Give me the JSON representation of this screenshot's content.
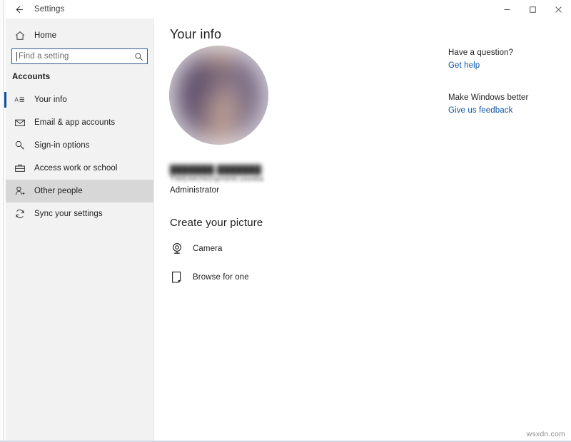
{
  "window": {
    "title": "Settings",
    "back_icon": "back-arrow-icon",
    "minimize_icon": "minimize-icon",
    "maximize_icon": "maximize-icon",
    "close_icon": "close-icon"
  },
  "sidebar": {
    "home": {
      "label": "Home",
      "icon": "home-icon"
    },
    "search": {
      "placeholder": "Find a setting",
      "value": "",
      "icon": "search-icon"
    },
    "section_title": "Accounts",
    "items": [
      {
        "label": "Your info",
        "icon": "contact-card-icon",
        "state": "selected"
      },
      {
        "label": "Email & app accounts",
        "icon": "envelope-icon",
        "state": "normal"
      },
      {
        "label": "Sign-in options",
        "icon": "key-icon",
        "state": "normal"
      },
      {
        "label": "Access work or school",
        "icon": "briefcase-icon",
        "state": "normal"
      },
      {
        "label": "Other people",
        "icon": "person-add-icon",
        "state": "hovered"
      },
      {
        "label": "Sync your settings",
        "icon": "sync-icon",
        "state": "normal"
      }
    ]
  },
  "main": {
    "page_title": "Your info",
    "account": {
      "avatar": "user-avatar-image",
      "name": "███████ ███████",
      "path": "TWEAKING\\prishti.usodia",
      "role": "Administrator"
    },
    "create_picture": {
      "heading": "Create your picture",
      "options": [
        {
          "label": "Camera",
          "icon": "camera-icon"
        },
        {
          "label": "Browse for one",
          "icon": "browse-file-icon"
        }
      ]
    }
  },
  "right_rail": {
    "question_heading": "Have a question?",
    "question_link": "Get help",
    "feedback_heading": "Make Windows better",
    "feedback_link": "Give us feedback"
  },
  "watermark": "wsxdn.com",
  "colors": {
    "accent": "#0b4f9e",
    "link": "#0b52a8",
    "sidebar_bg": "#f2f2f2",
    "hover_bg": "#d7d7d7"
  }
}
